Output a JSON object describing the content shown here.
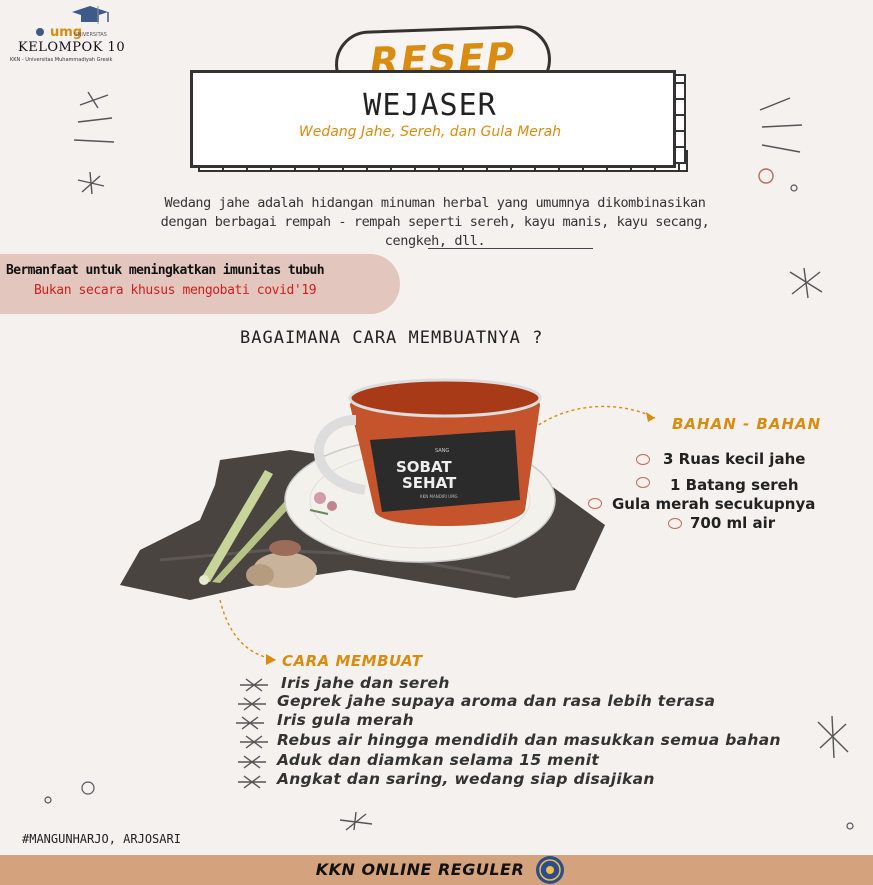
{
  "header": {
    "group_name": "KELOMPOK 10",
    "group_subtitle": "KKN - Universitas Muhammadiyah Gresik"
  },
  "recipe": {
    "badge": "RESEP",
    "title": "WEJASER",
    "subtitle": "Wedang Jahe, Sereh, dan Gula Merah",
    "description": "Wedang jahe adalah hidangan minuman herbal yang umumnya dikombinasikan dengan berbagai rempah - rempah seperti sereh, kayu manis, kayu secang, cengkeh, dll."
  },
  "banner": {
    "benefit": "Bermanfaat untuk meningkatkan imunitas tubuh",
    "warning": "Bukan secara khusus mengobati covid'19"
  },
  "question": "BAGAIMANA CARA MEMBUATNYA ?",
  "photo": {
    "mug_label_top": "SANG",
    "mug_label_main1": "SOBAT",
    "mug_label_main2": "SEHAT",
    "mug_label_sub": "KKN MANDIRI UMG"
  },
  "ingredients": {
    "title": "BAHAN - BAHAN",
    "items": [
      "3 Ruas kecil jahe",
      "1 Batang sereh",
      "Gula merah secukupnya",
      "700 ml air"
    ]
  },
  "steps": {
    "title": "CARA MEMBUAT",
    "items": [
      "Iris jahe dan sereh",
      "Geprek jahe supaya aroma dan rasa lebih terasa",
      "Iris gula merah",
      "Rebus air hingga mendidih dan masukkan semua bahan",
      "Aduk dan diamkan selama 15 menit",
      "Angkat dan saring, wedang siap disajikan"
    ]
  },
  "footer": {
    "location": "MANGUNHARJO, ARJOSARI",
    "program": "KKN ONLINE REGULER"
  },
  "colors": {
    "accent": "#d98c10",
    "warning": "#d21e1e",
    "banner": "#e3c7be",
    "footer_bar": "#d4a37e"
  }
}
